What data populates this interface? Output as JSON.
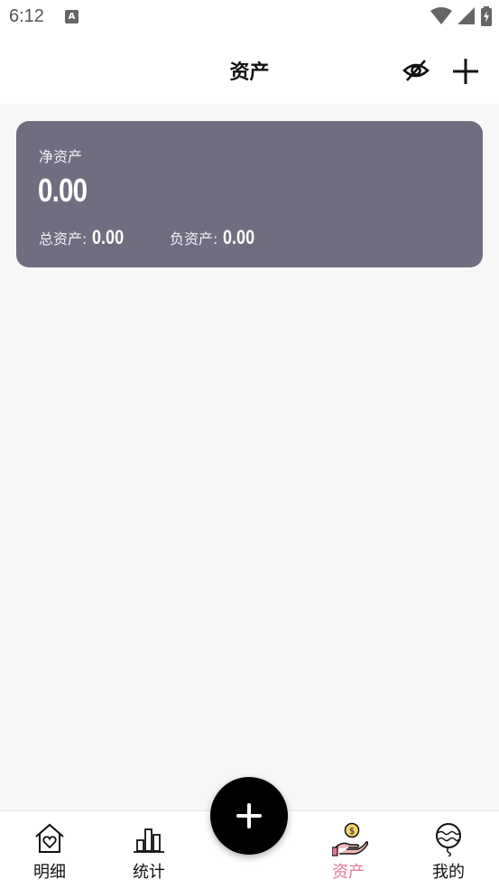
{
  "status_bar": {
    "time": "6:12",
    "notification_letter": "A"
  },
  "header": {
    "title": "资产"
  },
  "asset_card": {
    "net_label": "净资产",
    "net_value": "0.00",
    "total_label": "总资产:",
    "total_value": "0.00",
    "liability_label": "负资产:",
    "liability_value": "0.00",
    "background_color": "#716c7f"
  },
  "tabbar": {
    "items": [
      {
        "label": "明细",
        "icon": "house-heart-icon"
      },
      {
        "label": "统计",
        "icon": "bar-chart-icon"
      },
      {
        "label": "资产",
        "icon": "hand-coin-icon",
        "active": true
      },
      {
        "label": "我的",
        "icon": "balloon-icon"
      }
    ],
    "active_color": "#e07a93"
  }
}
